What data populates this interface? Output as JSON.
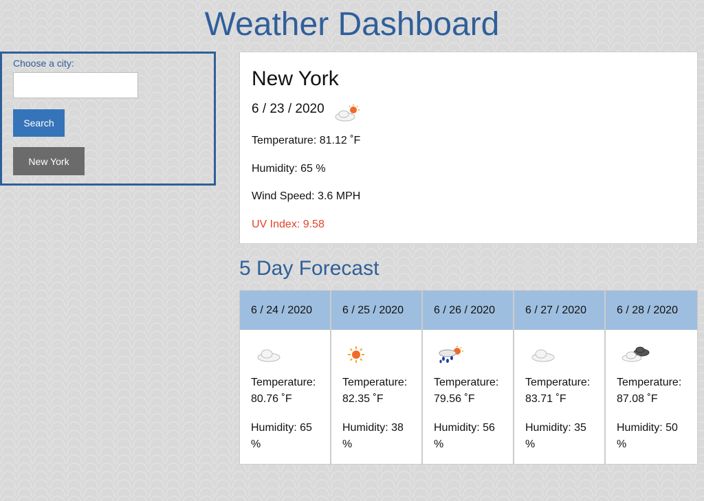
{
  "header": {
    "title": "Weather Dashboard"
  },
  "search": {
    "label": "Choose a city:",
    "input_value": "",
    "button_label": "Search",
    "history": [
      "New York"
    ]
  },
  "current": {
    "city": "New York",
    "date": "6 / 23 / 2020",
    "icon": "partly-sunny-icon",
    "temperature": "Temperature: 81.12 ˚F",
    "humidity": "Humidity: 65 %",
    "wind": "Wind Speed: 3.6 MPH",
    "uv": "UV Index: 9.58",
    "uv_color": "#e0432b"
  },
  "forecast": {
    "title": "5 Day Forecast",
    "days": [
      {
        "date": "6 / 24 / 2020",
        "icon": "cloud-icon",
        "temp_label": "Temperature:",
        "temp": "80.76 ˚F",
        "humidity_label": "Humidity: 65",
        "humidity_unit": "%"
      },
      {
        "date": "6 / 25 / 2020",
        "icon": "sun-icon",
        "temp_label": "Temperature:",
        "temp": "82.35 ˚F",
        "humidity_label": "Humidity: 38",
        "humidity_unit": "%"
      },
      {
        "date": "6 / 26 / 2020",
        "icon": "sun-rain-icon",
        "temp_label": "Temperature:",
        "temp": "79.56 ˚F",
        "humidity_label": "Humidity: 56",
        "humidity_unit": "%"
      },
      {
        "date": "6 / 27 / 2020",
        "icon": "cloud-icon",
        "temp_label": "Temperature:",
        "temp": "83.71 ˚F",
        "humidity_label": "Humidity: 35",
        "humidity_unit": "%"
      },
      {
        "date": "6 / 28 / 2020",
        "icon": "dark-clouds-icon",
        "temp_label": "Temperature:",
        "temp": "87.08 ˚F",
        "humidity_label": "Humidity: 50",
        "humidity_unit": "%"
      }
    ]
  },
  "colors": {
    "accent": "#2f5f9a",
    "forecast_header": "#9ebedf",
    "search_button": "#3574b8",
    "history_button": "#6b6b6b"
  }
}
